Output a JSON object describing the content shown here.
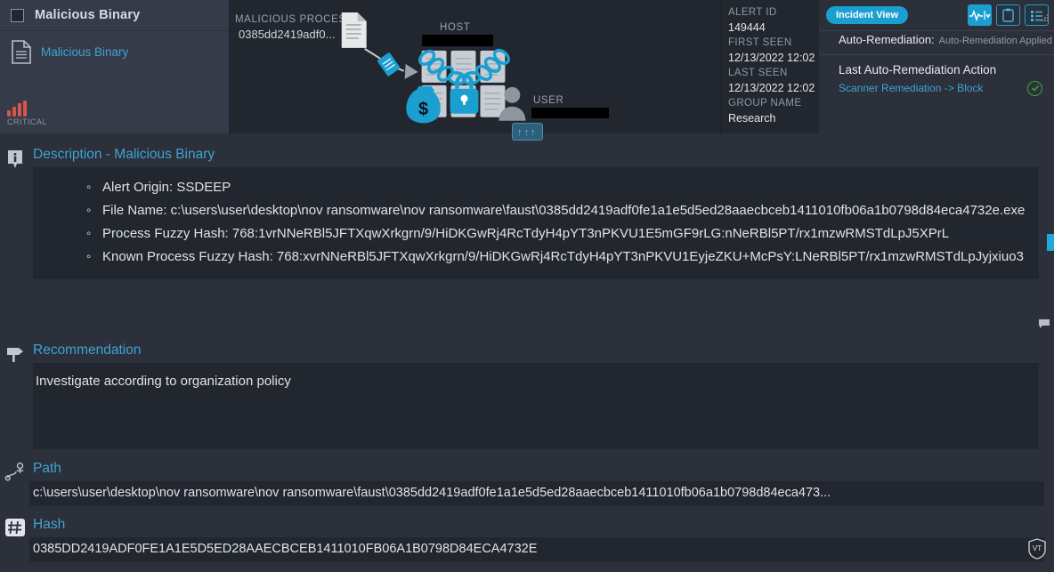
{
  "alert_card": {
    "title": "Malicious Binary",
    "link_label": "Malicious Binary",
    "severity_label": "CRITICAL",
    "severity_color": "#d9534f"
  },
  "graphic": {
    "process_label": "MALICIOUS PROCESS",
    "process_name": "0385dd2419adf0...",
    "host_label": "HOST",
    "host_name_redacted": true,
    "user_label": "USER",
    "user_name_redacted": true
  },
  "meta": {
    "alert_id_label": "ALERT ID",
    "alert_id": "149444",
    "first_seen_label": "FIRST SEEN",
    "first_seen": "12/13/2022 12:02",
    "last_seen_label": "LAST SEEN",
    "last_seen": "12/13/2022 12:02",
    "group_name_label": "GROUP NAME",
    "group_name": "Research"
  },
  "right_panel": {
    "incident_view_label": "Incident View",
    "auto_remediation_label": "Auto-Remediation:",
    "auto_remediation_status": "Auto-Remediation Applied",
    "last_action_title": "Last Auto-Remediation Action",
    "last_action_value": "Scanner Remediation -> Block",
    "accent_color": "#1a9fd0",
    "success_color": "#3aa83a"
  },
  "description": {
    "title": "Description - Malicious Binary",
    "items": [
      "Alert Origin: SSDEEP",
      "File Name: c:\\users\\user\\desktop\\nov ransomware\\nov ransomware\\faust\\0385dd2419adf0fe1a1e5d5ed28aaecbceb1411010fb06a1b0798d84eca4732e.exe",
      "Process Fuzzy Hash: 768:1vrNNeRBl5JFTXqwXrkgrn/9/HiDKGwRj4RcTdyH4pYT3nPKVU1E5mGF9rLG:nNeRBl5PT/rx1mzwRMSTdLpJ5XPrL",
      "Known Process Fuzzy Hash: 768:xvrNNeRBl5JFTXqwXrkgrn/9/HiDKGwRj4RcTdyH4pYT3nPKVU1EyjeZKU+McPsY:LNeRBl5PT/rx1mzwRMSTdLpJyjxiuo3"
    ]
  },
  "recommendation": {
    "title": "Recommendation",
    "text": "Investigate according to organization policy"
  },
  "path": {
    "title": "Path",
    "value": "c:\\users\\user\\desktop\\nov ransomware\\nov ransomware\\faust\\0385dd2419adf0fe1a1e5d5ed28aaecbceb1411010fb06a1b0798d84eca473..."
  },
  "hash": {
    "title": "Hash",
    "value": "0385DD2419ADF0FE1A1E5D5ED28AAECBCEB1411010FB06A1B0798D84ECA4732E",
    "vt_badge": "VT"
  }
}
